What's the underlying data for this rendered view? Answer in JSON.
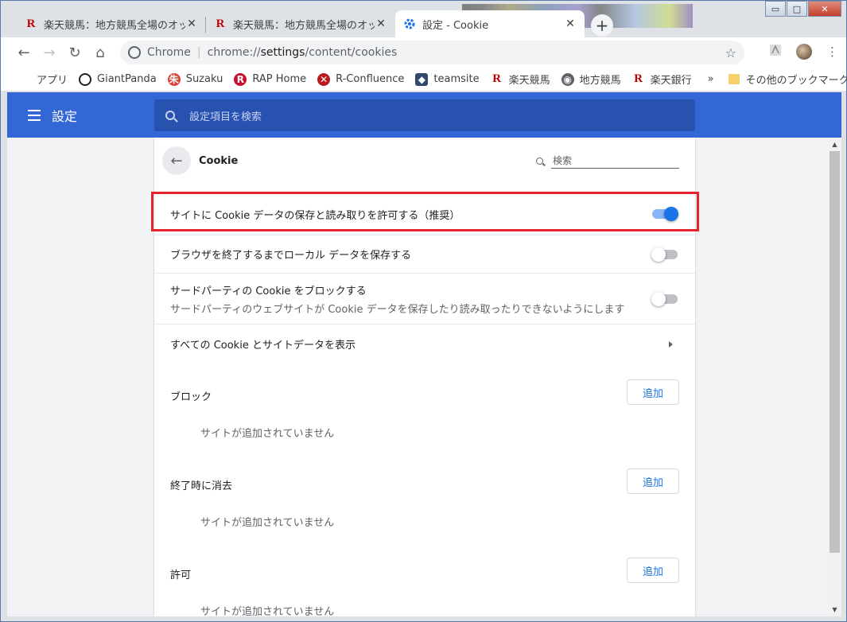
{
  "tabs": [
    {
      "icon": "R",
      "title": "楽天競馬：地方競馬全場のオッズ",
      "close": "✕"
    },
    {
      "icon": "R",
      "title": "楽天競馬：地方競馬全場のオッズ",
      "close": "✕"
    },
    {
      "icon": "gear",
      "title": "設定 - Cookie",
      "close": "✕"
    }
  ],
  "newtab_label": "+",
  "window_controls": {
    "minimize": "▭",
    "maximize": "□",
    "close": "✕"
  },
  "toolbar": {
    "back": "←",
    "forward": "→",
    "reload": "↻",
    "home": "⌂",
    "omnibox_site": "Chrome",
    "omnibox_url_prefix": "chrome://",
    "omnibox_url_main": "settings",
    "omnibox_url_suffix": "/content/cookies",
    "star": "☆",
    "menu": "⋮"
  },
  "bookmarks": [
    {
      "icon": "apps",
      "label": "アプリ"
    },
    {
      "icon": "panda",
      "label": "GiantPanda"
    },
    {
      "icon": "suzaku",
      "label": "Suzaku"
    },
    {
      "icon": "rap",
      "label": "RAP Home"
    },
    {
      "icon": "rconf",
      "label": "R-Confluence"
    },
    {
      "icon": "teamsite",
      "label": "teamsite"
    },
    {
      "icon": "R",
      "label": "楽天競馬"
    },
    {
      "icon": "globe",
      "label": "地方競馬"
    },
    {
      "icon": "R",
      "label": "楽天銀行"
    }
  ],
  "bookmarks_overflow": "»",
  "other_bookmarks": "その他のブックマーク",
  "settings": {
    "title": "設定",
    "search_placeholder": "設定項目を検索"
  },
  "cookie_page": {
    "title": "Cookie",
    "search_placeholder": "検索",
    "rows": [
      {
        "label": "サイトに Cookie データの保存と読み取りを許可する（推奨）",
        "toggle": true
      },
      {
        "label": "ブラウザを終了するまでローカル データを保存する",
        "toggle": false
      },
      {
        "label": "サードパーティの Cookie をブロックする",
        "sublabel": "サードパーティのウェブサイトが Cookie データを保存したり読み取ったりできないようにします",
        "toggle": false
      },
      {
        "label": "すべての Cookie とサイトデータを表示"
      }
    ],
    "sections": [
      {
        "label": "ブロック",
        "button": "追加",
        "empty": "サイトが追加されていません"
      },
      {
        "label": "終了時に消去",
        "button": "追加",
        "empty": "サイトが追加されていません"
      },
      {
        "label": "許可",
        "button": "追加",
        "empty": "サイトが追加されていません"
      }
    ]
  },
  "colors": {
    "header": "#3367d6",
    "accent": "#1a73e8",
    "highlight": "#e3242b"
  }
}
